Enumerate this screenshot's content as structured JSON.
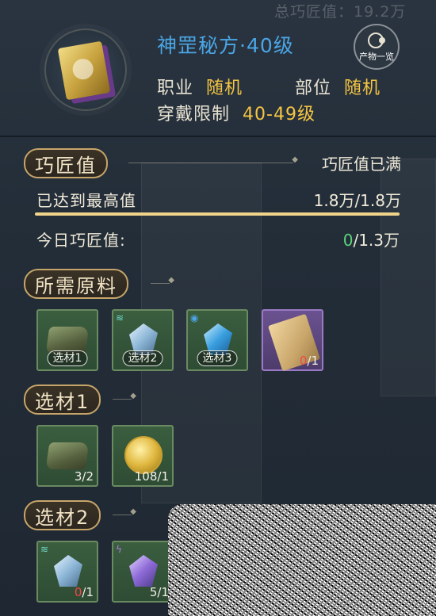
{
  "background": {
    "total_label": "总巧匠值：19.2万"
  },
  "header": {
    "title": "神罡秘方·40级",
    "profession_label": "职业",
    "profession_value": "随机",
    "slot_label": "部位",
    "slot_value": "随机",
    "wear_label": "穿戴限制",
    "wear_value": "40-49级",
    "catalog_button": "产物一览"
  },
  "craft": {
    "section_title": "巧匠值",
    "status": "巧匠值已满",
    "max_label": "已达到最高值",
    "max_value": "1.8万/1.8万",
    "progress": 1.0,
    "today_label": "今日巧匠值:",
    "today_current": "0",
    "today_total": "/1.3万"
  },
  "materials": {
    "section_title": "所需原料",
    "slots": [
      {
        "label": "选材1",
        "icon": "stone-icon"
      },
      {
        "label": "选材2",
        "icon": "crystal-icon"
      },
      {
        "label": "选材3",
        "icon": "crystal-icon"
      },
      {
        "qty_current": "0",
        "qty_total": "/1",
        "icon": "scroll-icon"
      }
    ]
  },
  "choice1": {
    "section_title": "选材1",
    "slots": [
      {
        "qty": "3/2",
        "icon": "stone-icon"
      },
      {
        "qty": "108/1",
        "icon": "coin-icon"
      }
    ]
  },
  "choice2": {
    "section_title": "选材2",
    "slots": [
      {
        "qty_current": "0",
        "qty_total": "/1",
        "icon": "crystal-icon"
      },
      {
        "qty": "5/1",
        "icon": "crystal-icon"
      }
    ]
  },
  "colors": {
    "accent_blue": "#4aa6e6",
    "accent_gold": "#f4c542",
    "green": "#5bd27a",
    "red": "#ef4848"
  }
}
